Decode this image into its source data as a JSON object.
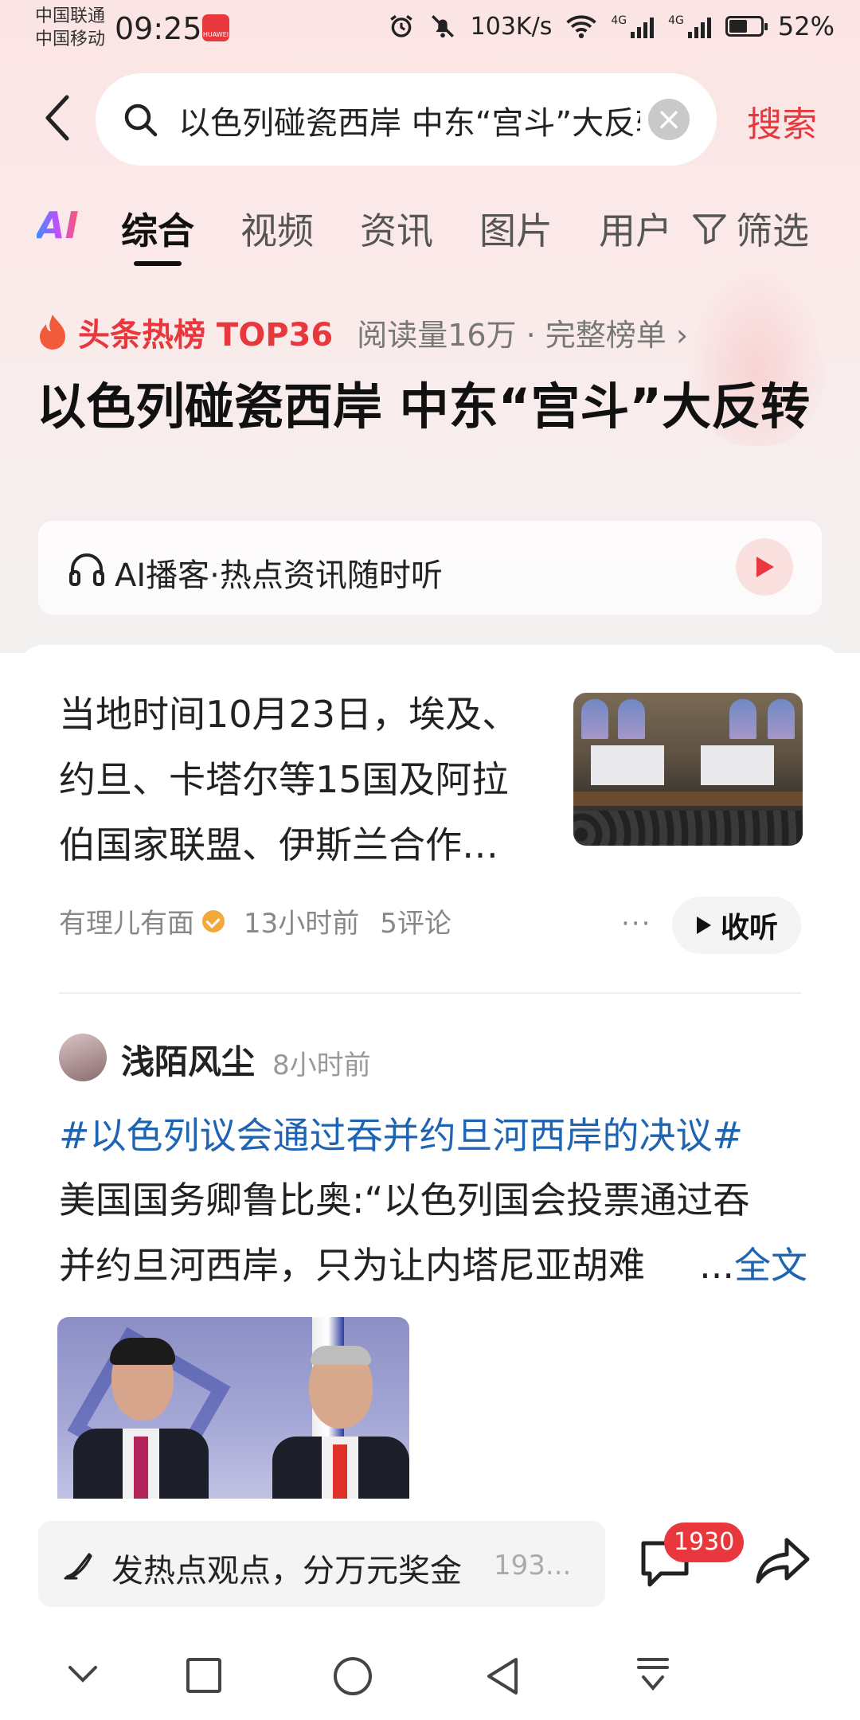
{
  "status_bar": {
    "carrier_1": "中国联通",
    "carrier_2": "中国移动",
    "time": "09:25",
    "app_badge": "HUAWEI",
    "net_speed": "103K/s",
    "sig_1_label": "4G",
    "sig_2_label": "4G",
    "battery": "52%"
  },
  "search": {
    "query": "以色列碰瓷西岸 中东“宫斗”大反转",
    "button": "搜索"
  },
  "tabs": {
    "ai": "AI",
    "items": [
      "综合",
      "视频",
      "资讯",
      "图片",
      "用户"
    ],
    "active": "综合",
    "filter": "筛选"
  },
  "hot": {
    "label": "头条热榜 TOP36",
    "meta": "阅读量16万 · 完整榜单 ›",
    "title": "以色列碰瓷西岸 中东“宫斗”大反转"
  },
  "podcast": {
    "text": "AI播客·热点资讯随时听"
  },
  "article": {
    "summary": "当地时间10月23日，埃及、约旦、卡塔尔等15国及阿拉伯国家联盟、伊斯兰合作…",
    "source": "有理儿有面",
    "time": "13小时前",
    "comments": "5评论",
    "more": "···",
    "listen": "收听"
  },
  "post": {
    "author": "浅陌风尘",
    "time": "8小时前",
    "hashtag": "#以色列议会通过吞并约旦河西岸的决议#",
    "body_line1": "美国国务卿鲁比奥:“以色列国会投票通过吞",
    "body_line2": "并约旦河西岸，只为让内塔尼亚胡难",
    "ellipsis": "...",
    "full_text": "全文"
  },
  "bottom_bar": {
    "prompt": "发热点观点，分万元奖金",
    "hint": "193...",
    "comment_count": "1930"
  },
  "colors": {
    "accent_red": "#e8383d",
    "link_blue": "#1f64b3"
  },
  "icons": [
    "back-icon",
    "search-icon",
    "clear-icon",
    "filter-icon",
    "fire-icon",
    "headphone-icon",
    "play-icon",
    "verified-icon",
    "more-icon",
    "pen-icon",
    "comment-icon",
    "share-icon",
    "nav-down-icon",
    "nav-square-icon",
    "nav-circle-icon",
    "nav-back-icon",
    "nav-menu-icon"
  ]
}
